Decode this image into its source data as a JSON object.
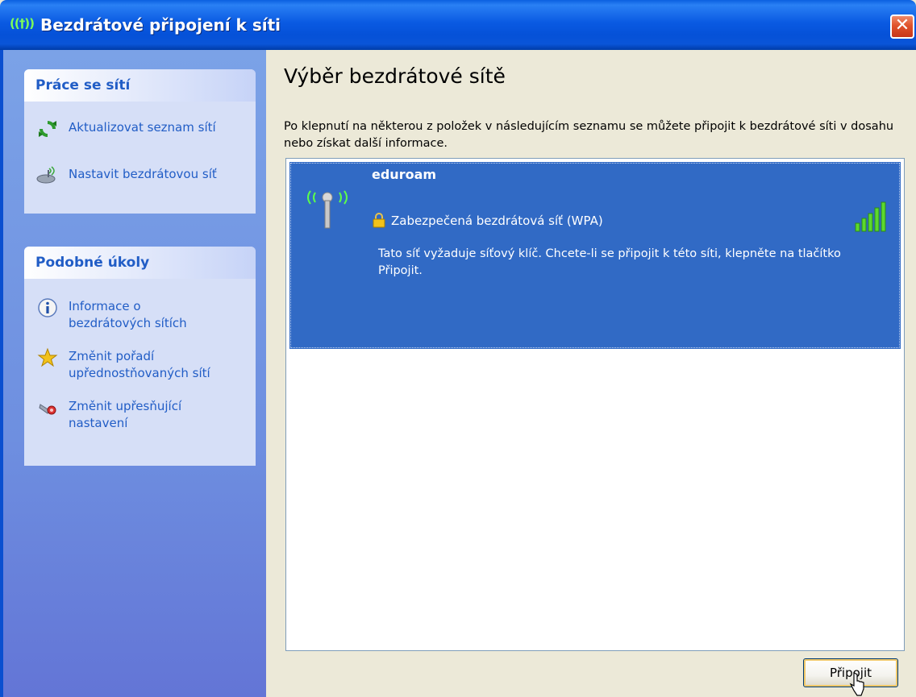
{
  "window": {
    "title": "Bezdrátové připojení k síti",
    "title_icon": "((†))",
    "close_glyph": "✕"
  },
  "sidebar": {
    "network_tasks": {
      "header": "Práce se sítí",
      "items": [
        {
          "label": "Aktualizovat seznam sítí",
          "icon": "refresh-icon"
        },
        {
          "label": "Nastavit bezdrátovou síť",
          "icon": "wireless-setup-icon"
        }
      ]
    },
    "related_tasks": {
      "header": "Podobné úkoly",
      "items": [
        {
          "label_line1": "Informace o",
          "label_line2": "bezdrátových sítích",
          "icon": "info-icon"
        },
        {
          "label_line1": "Změnit pořadí",
          "label_line2": "upřednostňovaných sítí",
          "icon": "star-icon"
        },
        {
          "label_line1": "Změnit upřesňující",
          "label_line2": "nastavení",
          "icon": "settings-icon"
        }
      ]
    }
  },
  "main": {
    "heading": "Výběr bezdrátové sítě",
    "description": "Po klepnutí na některou z položek v následujícím seznamu se můžete připojit k bezdrátové síti v dosahu nebo získat další informace.",
    "networks": [
      {
        "name": "eduroam",
        "security": "Zabezpečená bezdrátová síť (WPA)",
        "detail": "Tato síť vyžaduje síťový klíč. Chcete-li se připojit k této síti, klepněte na tlačítko Připojit.",
        "signal_bars": 5,
        "selected": true
      }
    ],
    "connect_button": "Připojit"
  },
  "colors": {
    "titlebar": "#0a55d8",
    "sidebar": "#7ba2e7",
    "selection": "#316ac5",
    "link": "#215dc6"
  }
}
